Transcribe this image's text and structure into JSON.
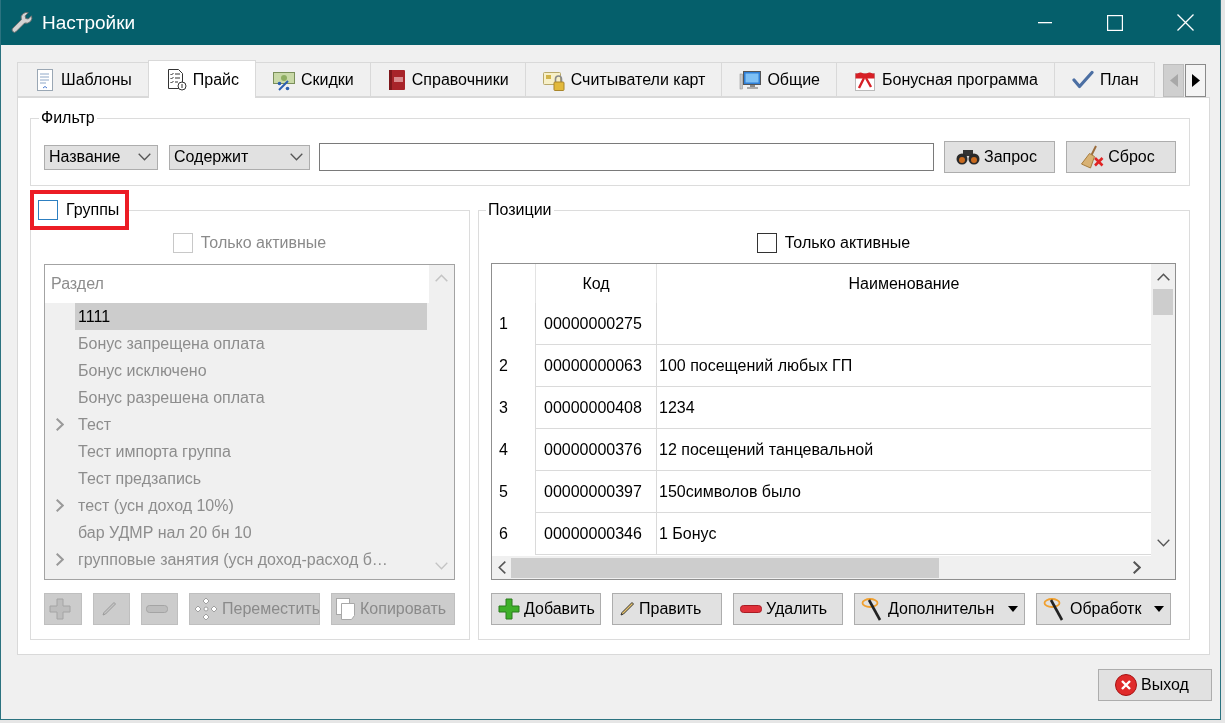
{
  "window": {
    "title": "Настройки"
  },
  "tabs": [
    {
      "label": "Шаблоны",
      "selected": false
    },
    {
      "label": "Прайс",
      "selected": true
    },
    {
      "label": "Скидки",
      "selected": false
    },
    {
      "label": "Справочники",
      "selected": false
    },
    {
      "label": "Считыватели карт",
      "selected": false
    },
    {
      "label": "Общие",
      "selected": false
    },
    {
      "label": "Бонусная программа",
      "selected": false
    },
    {
      "label": "План",
      "selected": false
    }
  ],
  "tab_scroll": [
    {
      "kind": "left",
      "disabled": true
    },
    {
      "kind": "right",
      "disabled": false
    }
  ],
  "filter": {
    "title": "Фильтр",
    "field": "Название",
    "condition": "Содержит",
    "buttons": [
      {
        "kind": "query",
        "label": "Запрос"
      },
      {
        "kind": "reset",
        "label": "Сброс"
      }
    ]
  },
  "groups": {
    "checkbox": {
      "label": "Группы",
      "checked": false
    },
    "disabled": true,
    "only_active": {
      "label": "Только активные",
      "checked": false
    },
    "tree": {
      "header": "Раздел",
      "items": [
        {
          "label": "1111",
          "selected": true,
          "expandable": false
        },
        {
          "label": "Бонус запрещена оплата",
          "selected": false,
          "expandable": false
        },
        {
          "label": "Бонус исключено",
          "selected": false,
          "expandable": false
        },
        {
          "label": "Бонус разрешена оплата",
          "selected": false,
          "expandable": false
        },
        {
          "label": "Тест",
          "selected": false,
          "expandable": true
        },
        {
          "label": "Тест импорта группа",
          "selected": false,
          "expandable": false
        },
        {
          "label": "Тест предзапись",
          "selected": false,
          "expandable": false
        },
        {
          "label": "тест (усн доход 10%)",
          "selected": false,
          "expandable": true
        },
        {
          "label": "бар УДМР нал 20 бн 10",
          "selected": false,
          "expandable": false
        },
        {
          "label": "групповые занятия (усн доход-расход б…",
          "selected": false,
          "expandable": true
        }
      ]
    },
    "buttons": [
      {
        "kind": "add"
      },
      {
        "kind": "edit"
      },
      {
        "kind": "remove"
      },
      {
        "kind": "move",
        "label": "Переместить"
      },
      {
        "kind": "copy",
        "label": "Копировать"
      }
    ]
  },
  "positions": {
    "title": "Позиции",
    "only_active": {
      "label": "Только активные",
      "checked": false
    },
    "table": {
      "columns": [
        "Код",
        "Наименование"
      ],
      "rows": [
        {
          "number": "1",
          "code": "00000000275"
        },
        {
          "number": "2",
          "code": "00000000063",
          "name": "100 посещений любых ГП"
        },
        {
          "number": "3",
          "code": "00000000408",
          "name": "1234"
        },
        {
          "number": "4",
          "code": "00000000376",
          "name": "12 посещений танцевальной"
        },
        {
          "number": "5",
          "code": "00000000397",
          "name": "150символов было"
        },
        {
          "number": "6",
          "code": "00000000346",
          "name": "1 Бонус"
        }
      ]
    },
    "buttons": [
      {
        "kind": "add",
        "label": "Добавить"
      },
      {
        "kind": "edit",
        "label": "Править"
      },
      {
        "kind": "remove",
        "label": "Удалить"
      },
      {
        "kind": "dropdown",
        "label": "Дополнительн"
      },
      {
        "kind": "dropdown",
        "label": "Обработк"
      }
    ]
  },
  "exit_button": {
    "label": "Выход"
  }
}
